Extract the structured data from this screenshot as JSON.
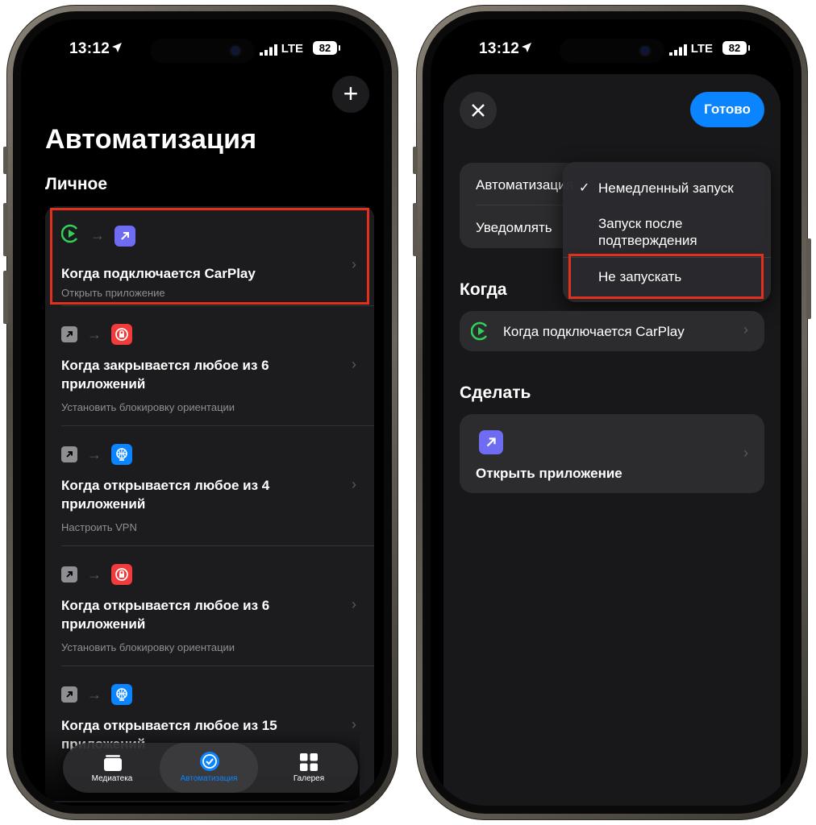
{
  "status": {
    "time": "13:12",
    "network": "LTE",
    "battery": "82"
  },
  "left": {
    "title": "Автоматизация",
    "section": "Личное",
    "items": [
      {
        "title": "Когда подключается CarPlay",
        "subtitle": "Открыть приложение"
      },
      {
        "title": "Когда закрывается любое из 6 приложений",
        "subtitle": "Установить блокировку ориентации"
      },
      {
        "title": "Когда открывается любое из 4 приложений",
        "subtitle": "Настроить VPN"
      },
      {
        "title": "Когда открывается любое из 6 приложений",
        "subtitle": "Установить блокировку ориентации"
      },
      {
        "title": "Когда открывается любое из 15 приложений",
        "subtitle": ""
      }
    ],
    "tabs": [
      {
        "label": "Медиатека"
      },
      {
        "label": "Автоматизация"
      },
      {
        "label": "Галерея"
      }
    ]
  },
  "right": {
    "done": "Готово",
    "settings": [
      {
        "label": "Автоматизация"
      },
      {
        "label": "Уведомлять"
      }
    ],
    "menu": [
      {
        "label": "Немедленный запуск",
        "checked": true
      },
      {
        "label": "Запуск после подтверждения",
        "checked": false
      },
      {
        "label": "Не запускать",
        "checked": false
      }
    ],
    "when_header": "Когда",
    "when_item": "Когда подключается CarPlay",
    "do_header": "Сделать",
    "do_item": "Открыть приложение"
  },
  "colors": {
    "accent": "#0a84ff",
    "highlight": "#e0301e",
    "carplay_green": "#30d158",
    "app_purple": "#6e6cf2",
    "lock_red": "#f23b3b",
    "vpn_blue": "#0a84ff"
  },
  "icons": {
    "carplay": "carplay-play-icon",
    "open_app": "arrow-up-right-icon",
    "lock": "orientation-lock-icon",
    "vpn": "globe-icon"
  }
}
